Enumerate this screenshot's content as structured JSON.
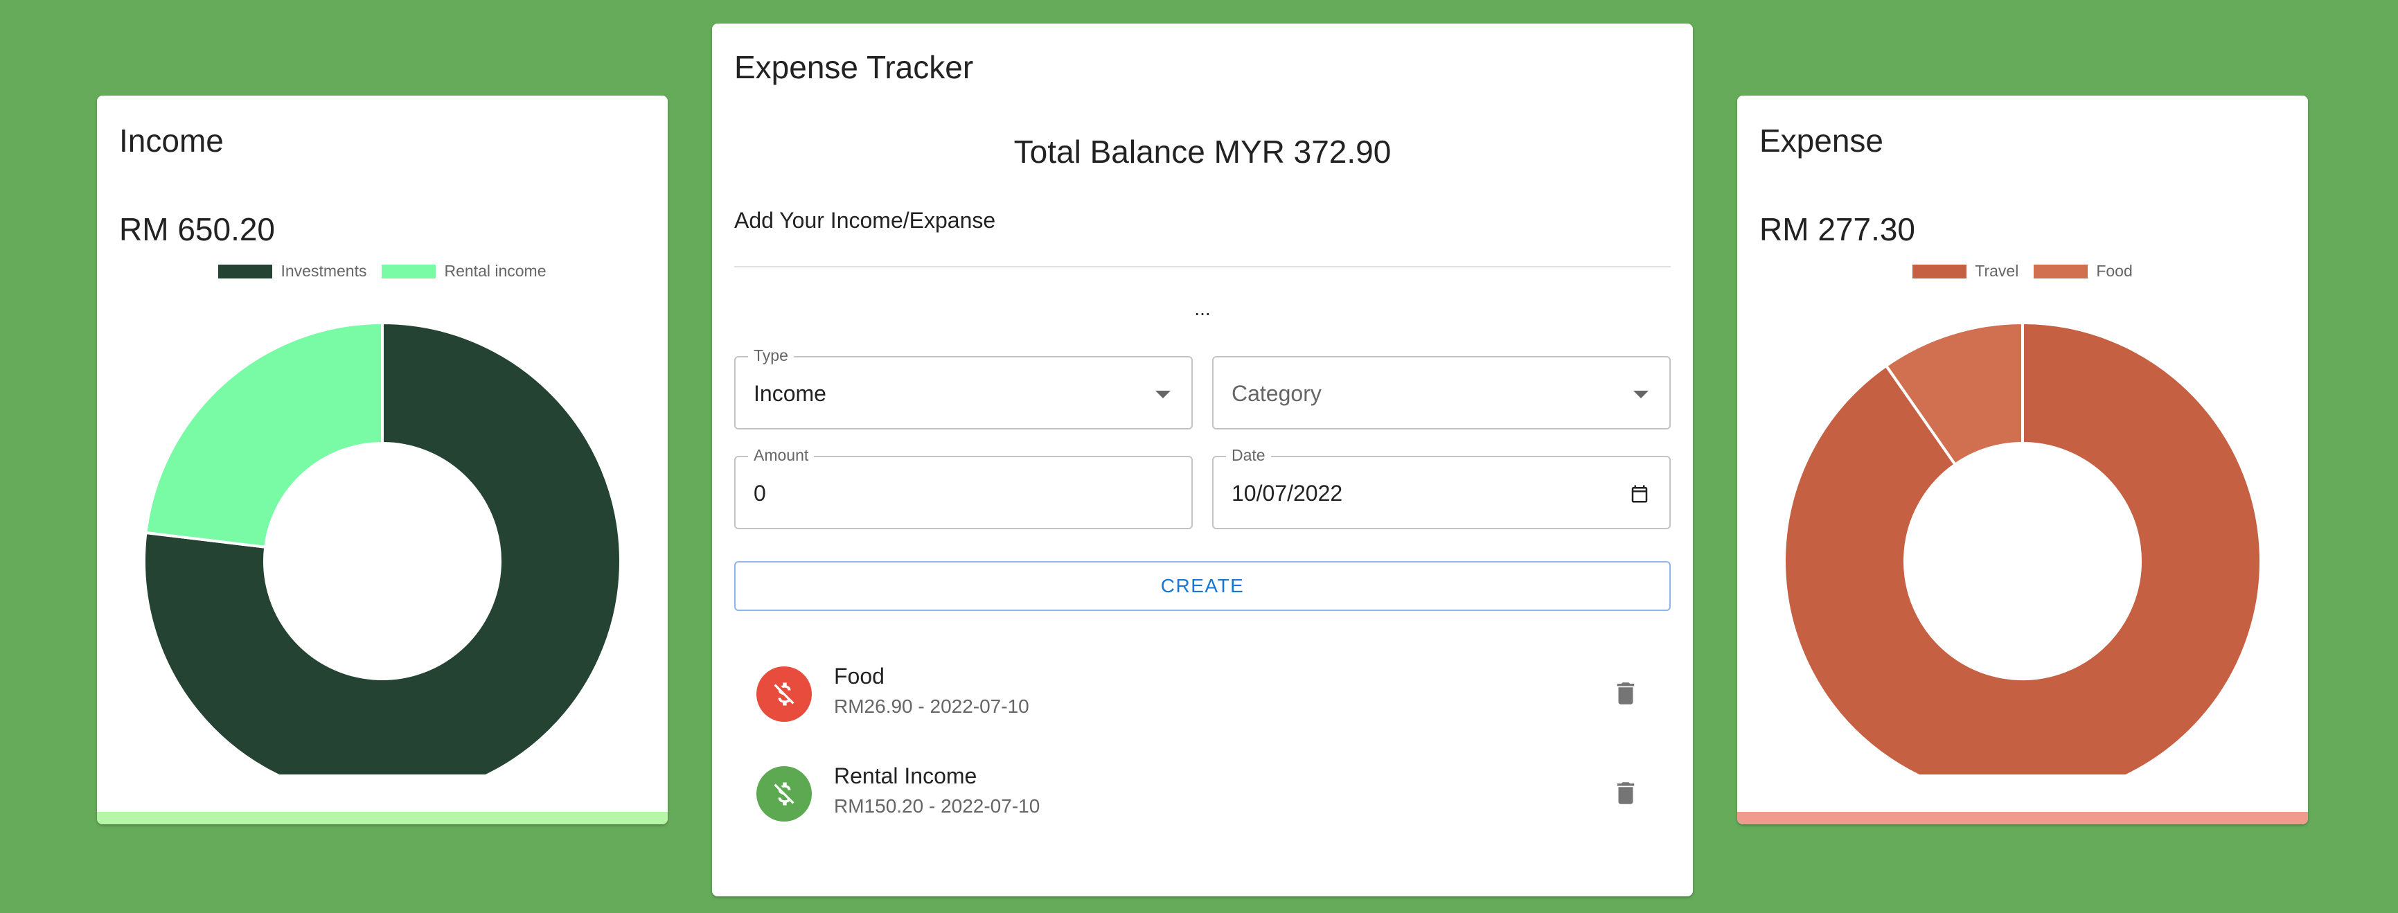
{
  "income": {
    "title": "Income",
    "amount": "RM 650.20",
    "bar_color": "#b7f5a8",
    "chart_data": {
      "type": "pie",
      "categories": [
        "Investments",
        "Rental income"
      ],
      "values": [
        500.0,
        150.2
      ],
      "colors": [
        "#244332",
        "#79fba6"
      ],
      "legend": "top"
    }
  },
  "tracker": {
    "title": "Expense Tracker",
    "balance": "Total Balance MYR 372.90",
    "subtitle": "Add Your Income/Expanse",
    "ellipsis": "...",
    "type_label": "Type",
    "type_value": "Income",
    "category_placeholder": "Category",
    "amount_label": "Amount",
    "amount_value": "0",
    "date_label": "Date",
    "date_value": "10/07/2022",
    "create_label": "CREATE",
    "transactions": [
      {
        "name": "Food",
        "meta": "RM26.90 - 2022-07-10",
        "color": "#e74c3c",
        "icon": "money-off-icon"
      },
      {
        "name": "Rental Income",
        "meta": "RM150.20 - 2022-07-10",
        "color": "#5da952",
        "icon": "money-off-icon"
      }
    ]
  },
  "expense": {
    "title": "Expense",
    "amount": "RM 277.30",
    "bar_color": "#f19b8e",
    "chart_data": {
      "type": "pie",
      "categories": [
        "Travel",
        "Food"
      ],
      "values": [
        250.4,
        26.9
      ],
      "colors": [
        "#c66043",
        "#d07050"
      ],
      "legend": "top"
    }
  }
}
